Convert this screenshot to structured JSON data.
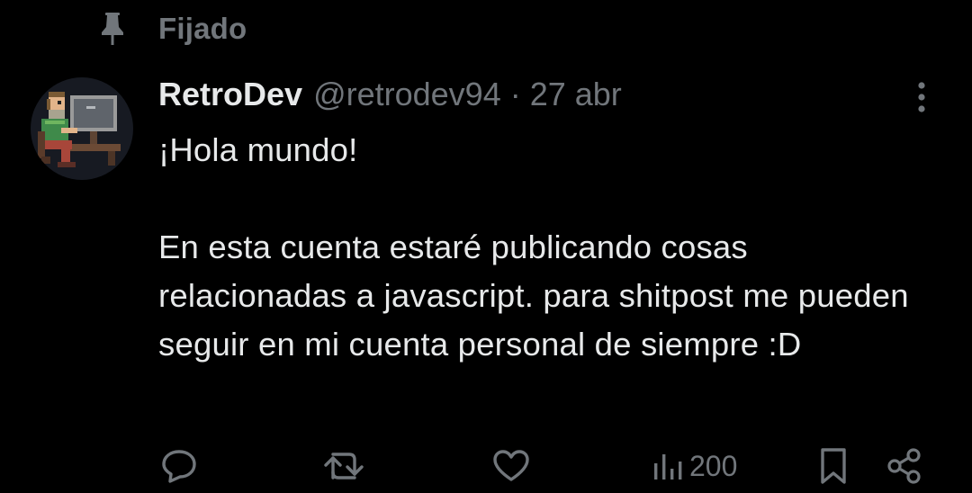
{
  "pinned": {
    "label": "Fijado",
    "icon": "pin-icon"
  },
  "author": {
    "display_name": "RetroDev",
    "handle": "@retrodev94",
    "separator": "·",
    "date": "27 abr",
    "avatar": "pixel-art-avatar"
  },
  "post": {
    "text": "¡Hola mundo!\n\nEn esta cuenta estaré publicando cosas relacionadas a javascript. para shitpost me pueden seguir en mi cuenta personal de siempre :D"
  },
  "actions": {
    "reply": "reply-icon",
    "repost": "repost-icon",
    "like": "like-icon",
    "views": {
      "icon": "views-icon",
      "count": "200"
    },
    "bookmark": "bookmark-icon",
    "share": "share-icon"
  },
  "colors": {
    "background": "#000000",
    "text_primary": "#e7e9ea",
    "text_secondary": "#71767b"
  }
}
